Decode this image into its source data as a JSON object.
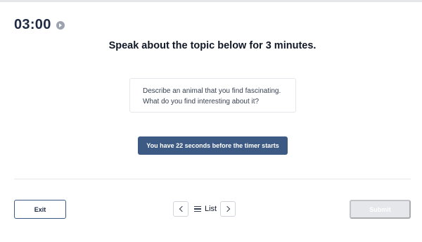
{
  "timer": {
    "value": "03:00",
    "icon": "play-circle-icon"
  },
  "instruction": "Speak about the topic below for 3 minutes.",
  "prompt": {
    "line1": "Describe an animal that you find fascinating.",
    "line2": "What do you find interesting about it?"
  },
  "countdown": {
    "text": "You have 22 seconds before the timer starts"
  },
  "footer": {
    "exit_label": "Exit",
    "list_label": "List",
    "submit_label": "Submit",
    "submit_disabled": true
  },
  "colors": {
    "primary": "#3c5a83",
    "text_dark": "#1f2a44",
    "disabled": "#e5e7eb"
  }
}
